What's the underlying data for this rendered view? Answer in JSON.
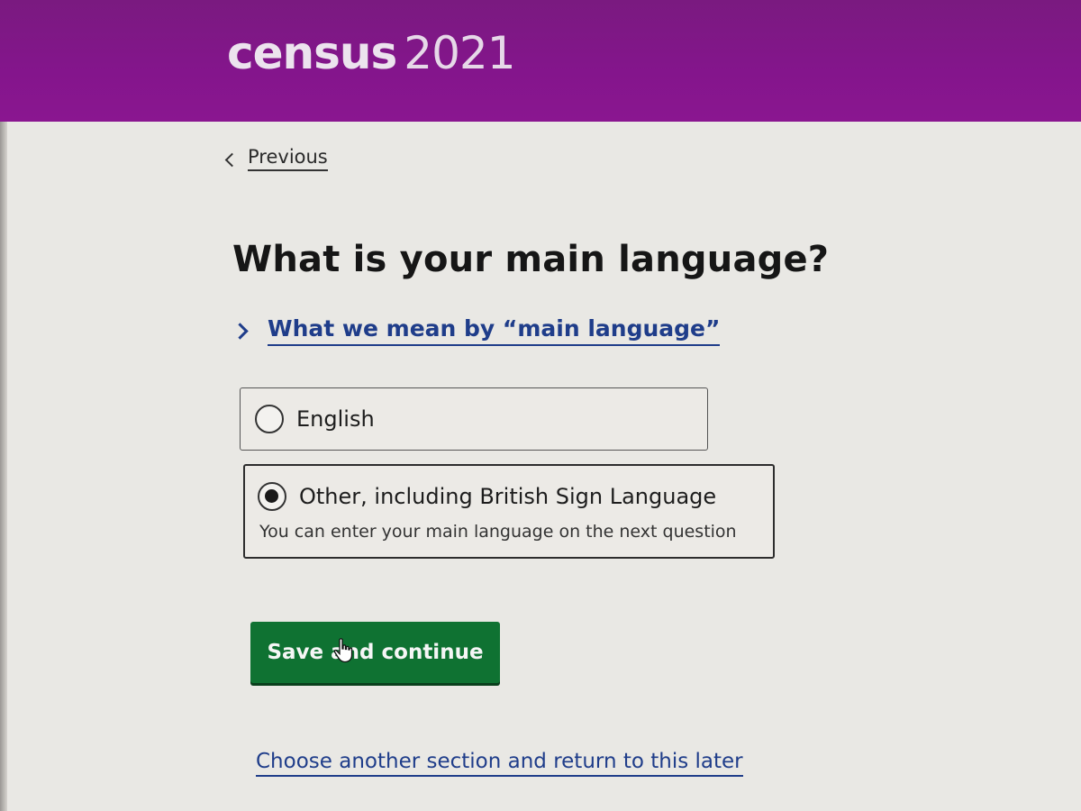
{
  "header": {
    "logo_word": "census",
    "logo_year": "2021",
    "background_color": "#84158c"
  },
  "navigation": {
    "previous_label": "Previous",
    "previous_icon": "chevron-left-icon"
  },
  "question": {
    "title": "What is your main language?",
    "details_label": "What we mean by “main language”",
    "details_icon": "chevron-right-icon"
  },
  "options": [
    {
      "label": "English",
      "selected": false
    },
    {
      "label": "Other, including British Sign Language",
      "hint": "You can enter your main language on the next question",
      "selected": true
    }
  ],
  "actions": {
    "save_label": "Save and continue",
    "save_color": "#0f7232",
    "later_label": "Choose another section and return to this later"
  },
  "colors": {
    "link": "#1f3d8a",
    "page_background": "#e9e8e4"
  }
}
